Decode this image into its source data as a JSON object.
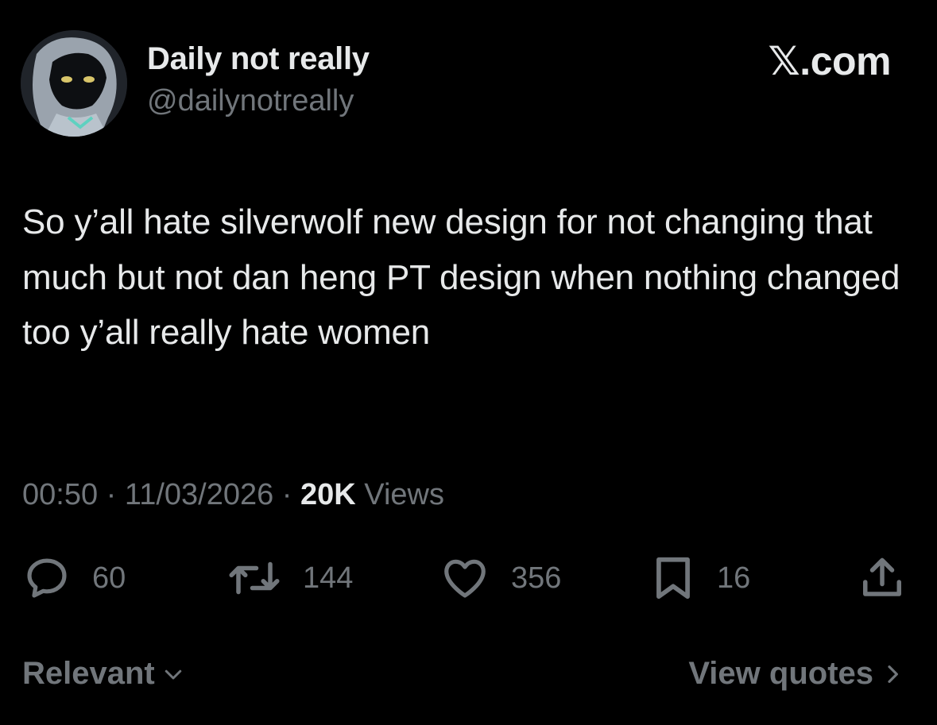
{
  "author": {
    "display_name": "Daily not really",
    "handle": "@dailynotreally"
  },
  "brand": "𝕏.com",
  "tweet": {
    "text": "So y’all hate silverwolf new design for not changing that much but not dan heng PT design when nothing changed too y’all really hate women"
  },
  "meta": {
    "time": "00:50",
    "separator": " · ",
    "date": "11/03/2026",
    "views_count": "20K",
    "views_label": " Views"
  },
  "actions": {
    "replies": "60",
    "reposts": "144",
    "likes": "356",
    "bookmarks": "16"
  },
  "icons": {
    "reply": "reply-icon",
    "repost": "repost-icon",
    "like": "heart-icon",
    "bookmark": "bookmark-icon",
    "share": "share-icon"
  },
  "footer": {
    "sort_label": "Relevant",
    "quotes_label": "View quotes"
  },
  "colors": {
    "background": "#000000",
    "primary_text": "#e7e9ea",
    "secondary_text": "#71767b"
  }
}
